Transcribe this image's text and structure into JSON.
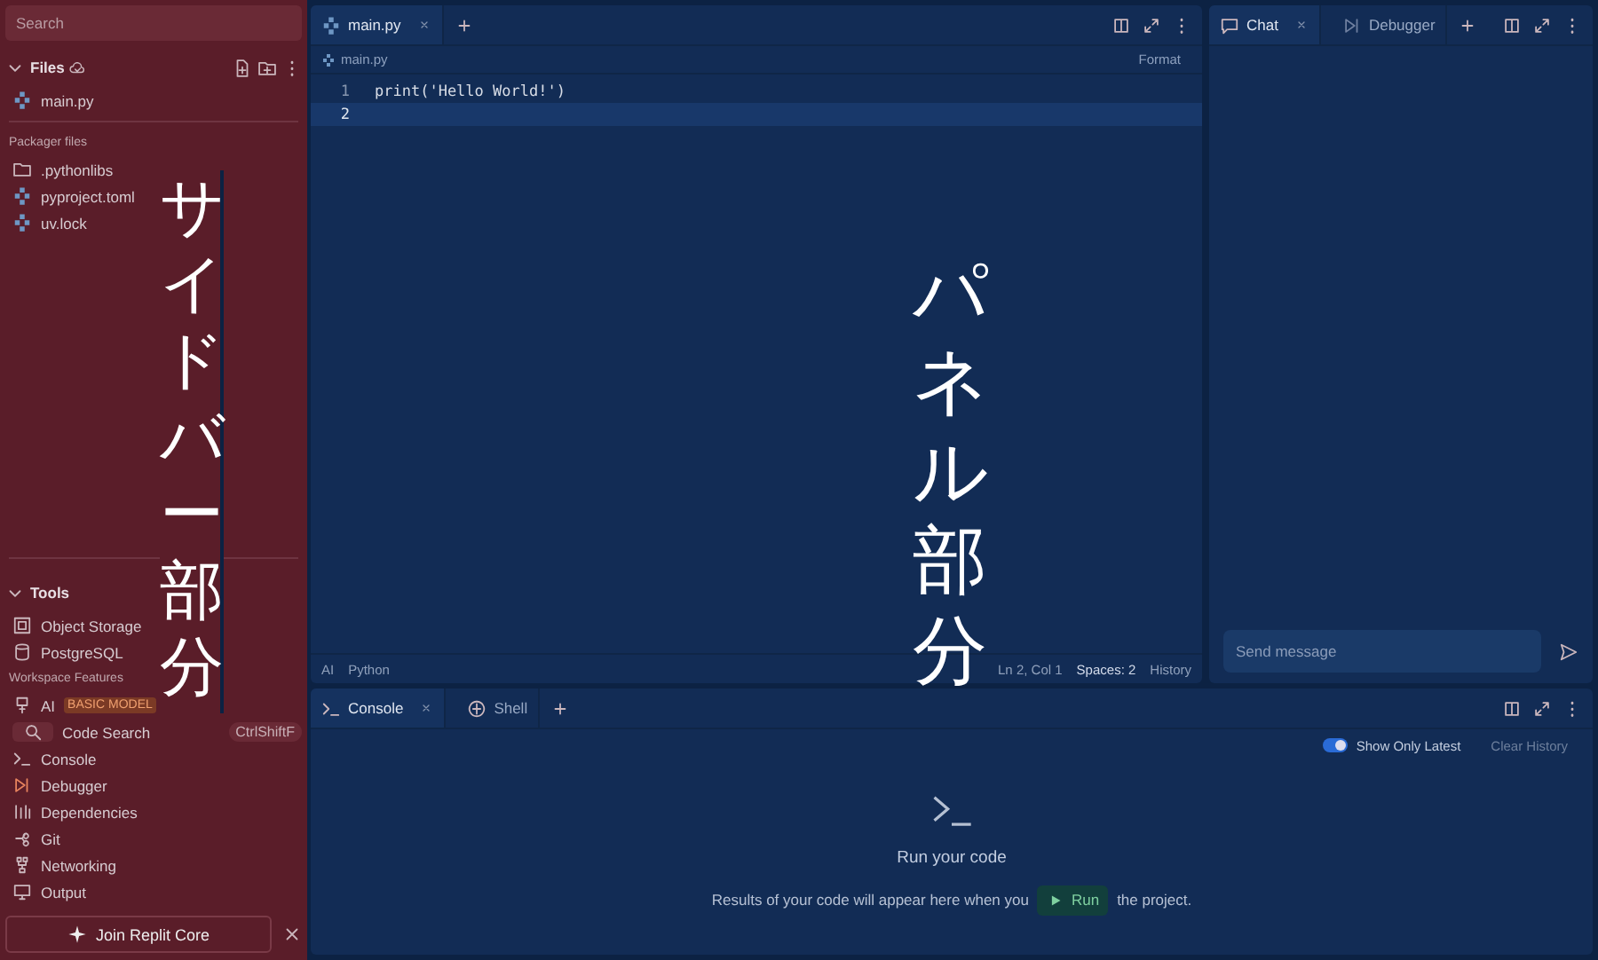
{
  "sidebar": {
    "search": {
      "placeholder": "Search"
    },
    "files": {
      "title": "Files",
      "expanded": true,
      "items": [
        {
          "name": "main.py",
          "kind": "python"
        }
      ],
      "group_label": "Packager files",
      "group_items": [
        {
          "name": ".pythonlibs",
          "kind": "folder"
        },
        {
          "name": "pyproject.toml",
          "kind": "python"
        },
        {
          "name": "uv.lock",
          "kind": "python"
        }
      ]
    },
    "tools": {
      "title": "Tools",
      "expanded": true,
      "items": [
        {
          "label": "Object Storage",
          "kind": "storage"
        },
        {
          "label": "PostgreSQL",
          "kind": "database"
        }
      ],
      "features_label": "Workspace Features",
      "features": [
        {
          "label": "AI",
          "kind": "ai",
          "badge": "BASIC MODEL"
        },
        {
          "label": "Code Search",
          "kind": "search",
          "shortcut": "CtrlShiftF"
        },
        {
          "label": "Console",
          "kind": "console"
        },
        {
          "label": "Debugger",
          "kind": "debugger"
        },
        {
          "label": "Dependencies",
          "kind": "dependencies"
        },
        {
          "label": "Git",
          "kind": "git"
        },
        {
          "label": "Networking",
          "kind": "network"
        },
        {
          "label": "Output",
          "kind": "output"
        }
      ]
    },
    "join_button": "Join Replit Core"
  },
  "editor": {
    "tabs": [
      {
        "label": "main.py",
        "selected": true
      }
    ],
    "breadcrumb": "main.py",
    "format_button": "Format",
    "lines": [
      {
        "number": "1",
        "code": "print('Hello World!')",
        "current": false
      },
      {
        "number": "2",
        "current": true
      }
    ],
    "status_bar": {
      "ai": "AI",
      "language": "Python",
      "cursor": "Ln 2, Col 1",
      "spaces": "Spaces: 2",
      "history": "History"
    }
  },
  "chat": {
    "tabs": [
      {
        "label": "Chat",
        "kind": "chat",
        "selected": true
      },
      {
        "label": "Debugger",
        "kind": "debugger",
        "selected": false
      }
    ],
    "input": {
      "placeholder": "Send message"
    }
  },
  "console": {
    "tabs": [
      {
        "label": "Console",
        "kind": "console",
        "selected": true
      },
      {
        "label": "Shell",
        "kind": "shell",
        "selected": false
      }
    ],
    "toggle": {
      "label": "Show Only Latest",
      "on": true
    },
    "clear_button": "Clear History",
    "empty": {
      "title": "Run your code",
      "message_before": "Results of your code will appear here when you",
      "run_button": "Run",
      "message_after": "the project."
    }
  },
  "sidebar_annotation": "サイドバー部分",
  "panel_annotation": "パネル部分"
}
